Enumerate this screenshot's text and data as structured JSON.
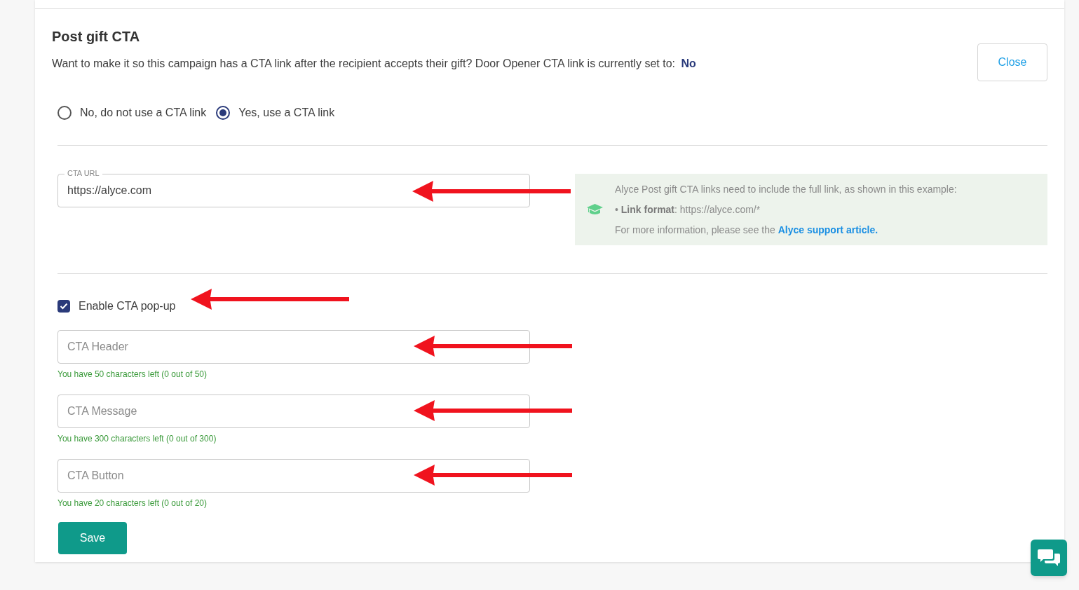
{
  "title": "Post gift CTA",
  "description": "Want to make it so this campaign has a CTA link after the recipient accepts their gift? Door Opener CTA link is currently set to:",
  "current_value": "No",
  "close_button": "Close",
  "radios": [
    {
      "label": "No, do not use a CTA link",
      "selected": false
    },
    {
      "label": "Yes, use a CTA link",
      "selected": true
    }
  ],
  "url_field": {
    "label": "CTA URL",
    "value": "https://alyce.com",
    "arrow": true
  },
  "info": {
    "lines": [
      "Alyce Post gift CTA links need to include the full link, as shown in this example:",
      "• **Link format**: https://alyce.com/*",
      "For more information, please see the"
    ],
    "link": "Alyce support article."
  },
  "popup_checkbox": {
    "label": "Enable CTA pop-up",
    "checked": true,
    "arrow": true
  },
  "fields": [
    {
      "placeholder": "CTA Header",
      "hint": "You have 50 characters left (0 out of 50)",
      "arrow": true
    },
    {
      "placeholder": "CTA Message",
      "hint": "You have 300 characters left (0 out of 300)",
      "arrow": true
    },
    {
      "placeholder": "CTA Button",
      "hint": "You have 20 characters left (0 out of 20)",
      "arrow": true
    }
  ],
  "save_button": "Save"
}
